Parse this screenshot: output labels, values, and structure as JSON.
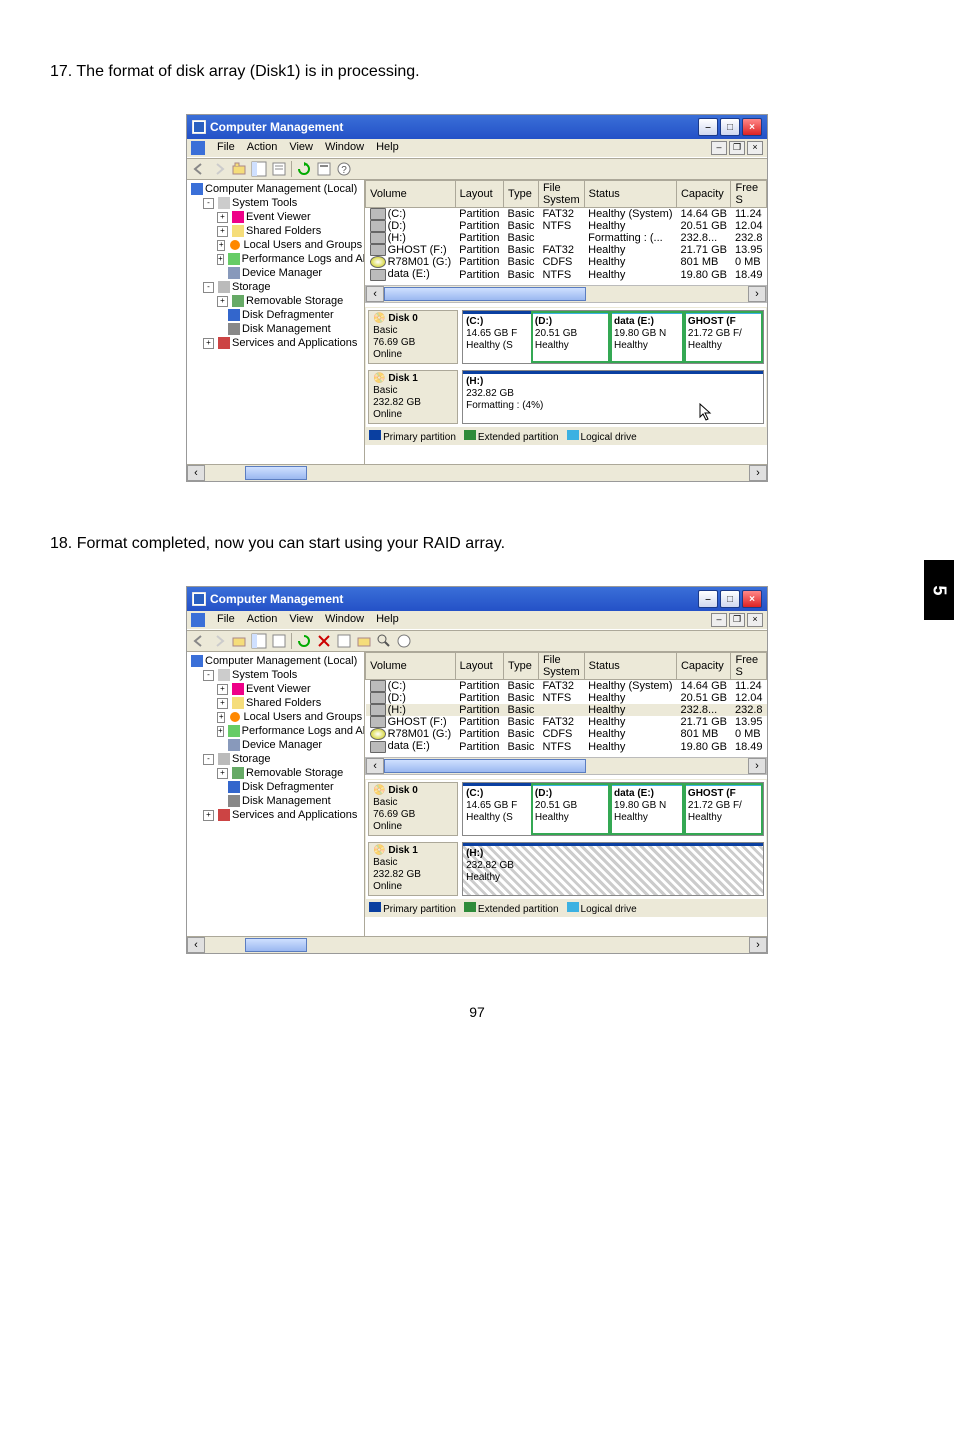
{
  "text": {
    "step17": "17. The format of disk array (Disk1) is in processing.",
    "step18": "18. Format completed, now you can start using your RAID array.",
    "page_num": "97",
    "side_tab": "5"
  },
  "win": {
    "title": "Computer Management",
    "menus": [
      "File",
      "Action",
      "View",
      "Window",
      "Help"
    ]
  },
  "tree": {
    "root": "Computer Management (Local)",
    "system_tools": "System Tools",
    "event_viewer": "Event Viewer",
    "shared_folders": "Shared Folders",
    "local_users": "Local Users and Groups",
    "perf_logs": "Performance Logs and Alerts",
    "device_mgr": "Device Manager",
    "storage": "Storage",
    "removable": "Removable Storage",
    "defrag": "Disk Defragmenter",
    "diskmgmt": "Disk Management",
    "services": "Services and Applications"
  },
  "columns": [
    "Volume",
    "Layout",
    "Type",
    "File System",
    "Status",
    "Capacity",
    "Free S"
  ],
  "volumes1": [
    {
      "v": "(C:)",
      "l": "Partition",
      "t": "Basic",
      "fs": "FAT32",
      "s": "Healthy (System)",
      "c": "14.64 GB",
      "f": "11.24"
    },
    {
      "v": "(D:)",
      "l": "Partition",
      "t": "Basic",
      "fs": "NTFS",
      "s": "Healthy",
      "c": "20.51 GB",
      "f": "12.04"
    },
    {
      "v": "(H:)",
      "l": "Partition",
      "t": "Basic",
      "fs": "",
      "s": "Formatting : (...",
      "c": "232.8...",
      "f": "232.8"
    },
    {
      "v": "GHOST (F:)",
      "l": "Partition",
      "t": "Basic",
      "fs": "FAT32",
      "s": "Healthy",
      "c": "21.71 GB",
      "f": "13.95"
    },
    {
      "v": "R78M01 (G:)",
      "l": "Partition",
      "t": "Basic",
      "fs": "CDFS",
      "s": "Healthy",
      "c": "801 MB",
      "f": "0 MB"
    },
    {
      "v": "data (E:)",
      "l": "Partition",
      "t": "Basic",
      "fs": "NTFS",
      "s": "Healthy",
      "c": "19.80 GB",
      "f": "18.49"
    }
  ],
  "volumes2": [
    {
      "v": "(C:)",
      "l": "Partition",
      "t": "Basic",
      "fs": "FAT32",
      "s": "Healthy (System)",
      "c": "14.64 GB",
      "f": "11.24"
    },
    {
      "v": "(D:)",
      "l": "Partition",
      "t": "Basic",
      "fs": "NTFS",
      "s": "Healthy",
      "c": "20.51 GB",
      "f": "12.04"
    },
    {
      "v": "(H:)",
      "l": "Partition",
      "t": "Basic",
      "fs": "",
      "s": "Healthy",
      "c": "232.8...",
      "f": "232.8"
    },
    {
      "v": "GHOST (F:)",
      "l": "Partition",
      "t": "Basic",
      "fs": "FAT32",
      "s": "Healthy",
      "c": "21.71 GB",
      "f": "13.95"
    },
    {
      "v": "R78M01 (G:)",
      "l": "Partition",
      "t": "Basic",
      "fs": "CDFS",
      "s": "Healthy",
      "c": "801 MB",
      "f": "0 MB"
    },
    {
      "v": "data (E:)",
      "l": "Partition",
      "t": "Basic",
      "fs": "NTFS",
      "s": "Healthy",
      "c": "19.80 GB",
      "f": "18.49"
    }
  ],
  "disk0": {
    "name": "Disk 0",
    "type": "Basic",
    "size": "76.69 GB",
    "state": "Online",
    "parts": [
      {
        "name": "(C:)",
        "size": "14.65 GB F",
        "stat": "Healthy (S"
      },
      {
        "name": "(D:)",
        "size": "20.51 GB",
        "stat": "Healthy"
      },
      {
        "name": "data (E:)",
        "size": "19.80 GB N",
        "stat": "Healthy"
      },
      {
        "name": "GHOST (F",
        "size": "21.72 GB F/",
        "stat": "Healthy"
      }
    ]
  },
  "disk1a": {
    "name": "Disk 1",
    "type": "Basic",
    "size": "232.82 GB",
    "state": "Online",
    "part": {
      "name": "(H:)",
      "size": "232.82 GB",
      "stat": "Formatting : (4%)"
    }
  },
  "disk1b": {
    "name": "Disk 1",
    "type": "Basic",
    "size": "232.82 GB",
    "state": "Online",
    "part": {
      "name": "(H:)",
      "size": "232.82 GB",
      "stat": "Healthy"
    }
  },
  "legend": {
    "primary": "Primary partition",
    "extended": "Extended partition",
    "logical": "Logical drive"
  }
}
